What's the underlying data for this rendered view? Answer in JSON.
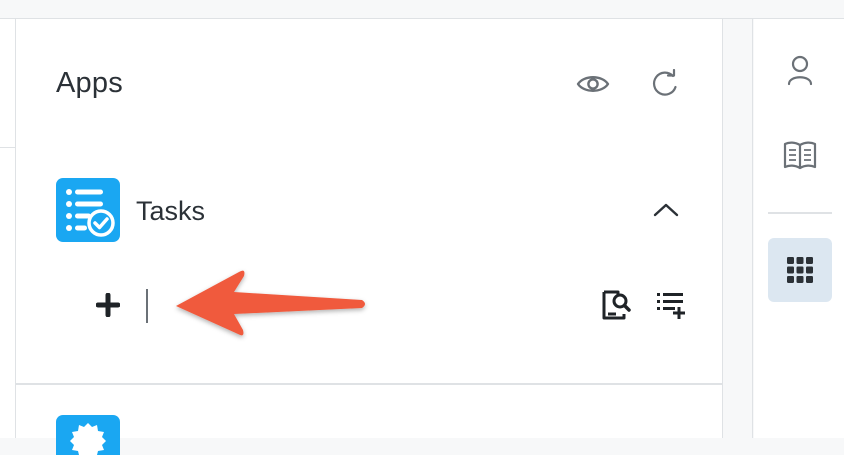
{
  "panel": {
    "title": "Apps",
    "icons": {
      "visibility": "eye-icon",
      "refresh": "refresh-icon"
    }
  },
  "app": {
    "name": "Tasks",
    "icon": "tasks-checklist-icon",
    "icon_color": "#1aa7f2",
    "expanded": true
  },
  "actions": {
    "add": "plus-icon",
    "search_documents": "search-document-icon",
    "add_list": "list-add-icon"
  },
  "rail": {
    "items": [
      {
        "icon": "user-icon",
        "active": false
      },
      {
        "icon": "book-icon",
        "active": false
      },
      {
        "icon": "apps-grid-icon",
        "active": true
      }
    ]
  },
  "annotation": {
    "type": "arrow",
    "color": "#f05a3c"
  }
}
